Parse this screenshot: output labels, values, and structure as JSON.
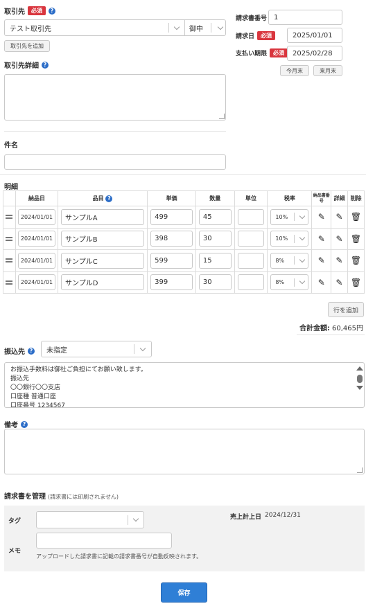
{
  "client": {
    "label": "取引先",
    "required": "必須",
    "value": "テスト取引先",
    "honorific": "御中",
    "add_button": "取引先を追加",
    "detail_label": "取引先詳細"
  },
  "invoice": {
    "number_label": "請求書番号",
    "number_value": "1",
    "date_label": "請求日",
    "date_required": "必須",
    "date_value": "2025/01/01",
    "due_label": "支払い期限",
    "due_required": "必須",
    "due_value": "2025/02/28",
    "this_month_end": "今月末",
    "next_month_end": "来月末"
  },
  "subject": {
    "label": "件名",
    "value": ""
  },
  "items": {
    "section_label": "明細",
    "headers": {
      "delivery_date": "納品日",
      "item": "品目",
      "unit_price": "単価",
      "quantity": "数量",
      "unit": "単位",
      "tax_rate": "税率",
      "delivery_note_no": "納品書番号",
      "detail": "詳細",
      "delete": "削除"
    },
    "rows": [
      {
        "date": "2024/01/01",
        "name": "サンプルA",
        "price": "499",
        "qty": "45",
        "unit": "",
        "tax": "10%"
      },
      {
        "date": "2024/01/01",
        "name": "サンプルB",
        "price": "398",
        "qty": "30",
        "unit": "",
        "tax": "10%"
      },
      {
        "date": "2024/01/01",
        "name": "サンプルC",
        "price": "599",
        "qty": "15",
        "unit": "",
        "tax": "8%"
      },
      {
        "date": "2024/01/01",
        "name": "サンプルD",
        "price": "399",
        "qty": "30",
        "unit": "",
        "tax": "8%"
      }
    ],
    "add_row_button": "行を追加",
    "total_label": "合計金額:",
    "total_value": "60,465円"
  },
  "bank": {
    "label": "振込先",
    "selected": "未指定",
    "text_lines": [
      "お振込手数料は御社ご負担にてお願い致します。",
      "振込先",
      "〇〇銀行〇〇支店",
      "口座種 普通口座",
      "口座番号 1234567"
    ]
  },
  "remarks": {
    "label": "備考",
    "value": ""
  },
  "manage": {
    "label": "請求書を管理",
    "note": "(請求書には印刷されません)",
    "tag_label": "タグ",
    "tag_value": "",
    "memo_label": "メモ",
    "memo_value": "",
    "upload_note": "アップロードした請求書に記載の請求書番号が自動反映されます。",
    "sales_date_label": "売上計上日",
    "sales_date_value": "2024/12/31"
  },
  "save_button": "保存",
  "colors": {
    "required_badge": "#d9363e",
    "help_icon": "#2d6ec8",
    "save_button": "#2f7fd6"
  },
  "icons": [
    "help-icon",
    "chevron-down-icon",
    "drag-handle-icon",
    "pencil-icon",
    "trash-icon",
    "resize-handle-icon",
    "scroll-up-icon",
    "scroll-down-icon"
  ]
}
